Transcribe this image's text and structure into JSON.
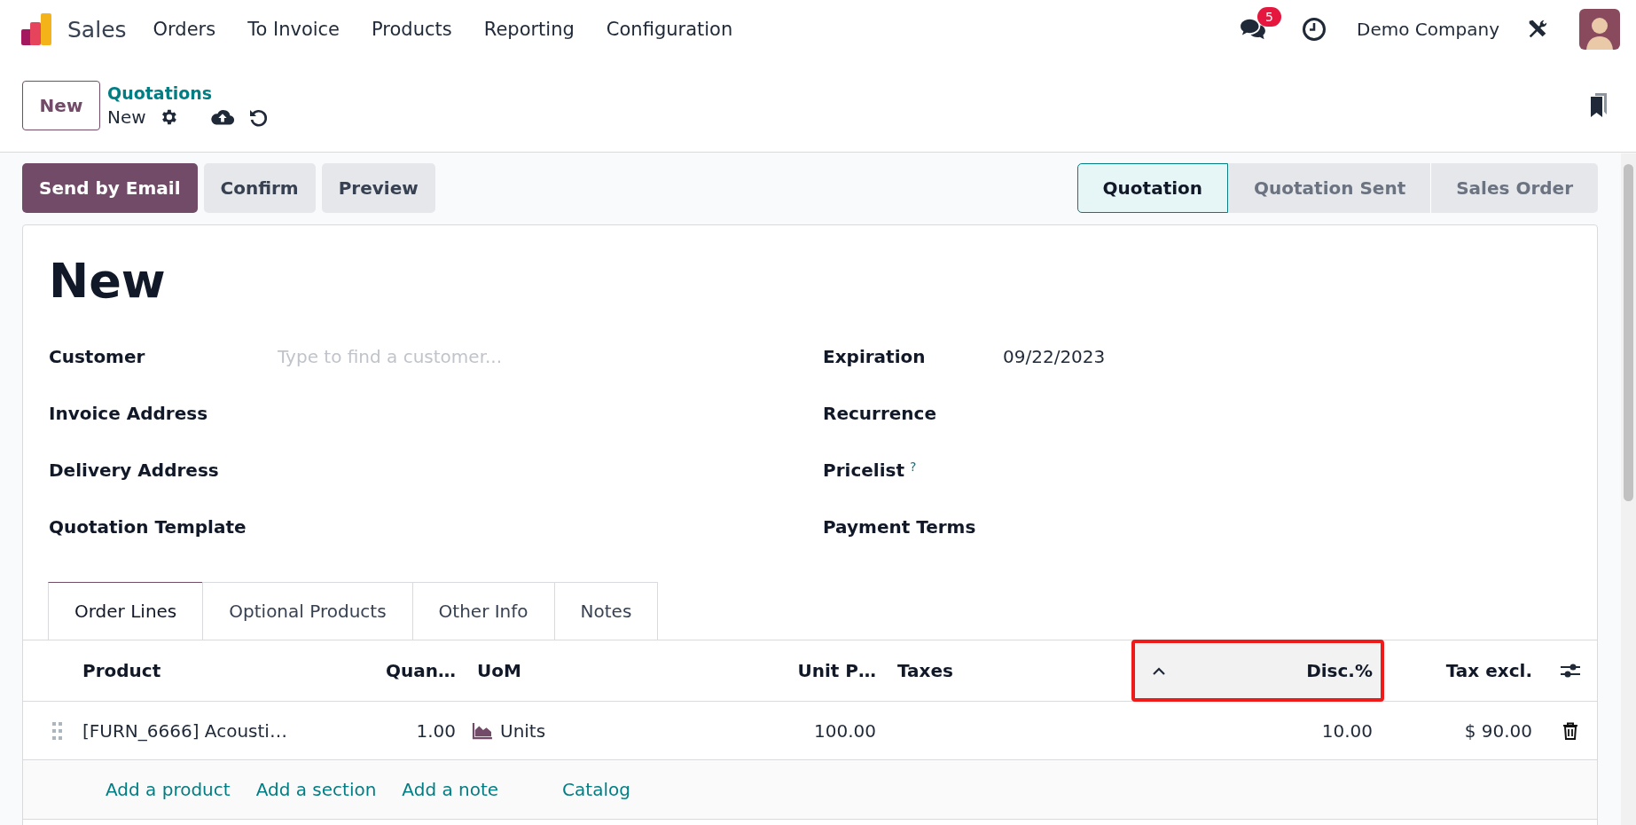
{
  "navbar": {
    "app_name": "Sales",
    "menu": [
      "Orders",
      "To Invoice",
      "Products",
      "Reporting",
      "Configuration"
    ],
    "messages_badge": "5",
    "company": "Demo Company"
  },
  "control_panel": {
    "new_button": "New",
    "breadcrumb": "Quotations",
    "record": "New"
  },
  "actions": [
    {
      "label": "Send by Email",
      "primary": true
    },
    {
      "label": "Confirm",
      "primary": false
    },
    {
      "label": "Preview",
      "primary": false
    }
  ],
  "status_steps": [
    {
      "label": "Quotation",
      "selected": true
    },
    {
      "label": "Quotation Sent",
      "selected": false
    },
    {
      "label": "Sales Order",
      "selected": false
    }
  ],
  "form": {
    "title": "New",
    "left_fields": [
      {
        "label": "Customer",
        "placeholder": "Type to find a customer..."
      },
      {
        "label": "Invoice Address"
      },
      {
        "label": "Delivery Address"
      },
      {
        "label": "Quotation Template"
      }
    ],
    "right_fields": [
      {
        "label": "Expiration",
        "value": "09/22/2023"
      },
      {
        "label": "Recurrence"
      },
      {
        "label": "Pricelist",
        "help": "?"
      },
      {
        "label": "Payment Terms"
      }
    ]
  },
  "tabs": [
    {
      "label": "Order Lines",
      "selected": true
    },
    {
      "label": "Optional Products",
      "selected": false
    },
    {
      "label": "Other Info",
      "selected": false
    },
    {
      "label": "Notes",
      "selected": false
    }
  ],
  "table": {
    "columns": [
      {
        "label": "Product",
        "highlighted": false,
        "sorted": false
      },
      {
        "label": "Quan…",
        "highlighted": false,
        "sorted": false
      },
      {
        "label": "UoM",
        "highlighted": false,
        "sorted": false
      },
      {
        "label": "Unit P…",
        "highlighted": false,
        "sorted": false
      },
      {
        "label": "Taxes",
        "highlighted": false,
        "sorted": false
      },
      {
        "label": "Disc.%",
        "highlighted": true,
        "sorted": true
      },
      {
        "label": "Tax excl.",
        "highlighted": false,
        "sorted": false
      }
    ],
    "rows": [
      {
        "product": "[FURN_6666] Acousti…",
        "quantity": "1.00",
        "uom": "Units",
        "unit_price": "100.00",
        "discount": "10.00",
        "subtotal": "$ 90.00"
      }
    ],
    "add_links": [
      {
        "label": "Add a product",
        "kind": "line"
      },
      {
        "label": "Add a section",
        "kind": "line"
      },
      {
        "label": "Add a note",
        "kind": "line"
      },
      {
        "label": "Catalog",
        "kind": "catalog"
      }
    ]
  }
}
